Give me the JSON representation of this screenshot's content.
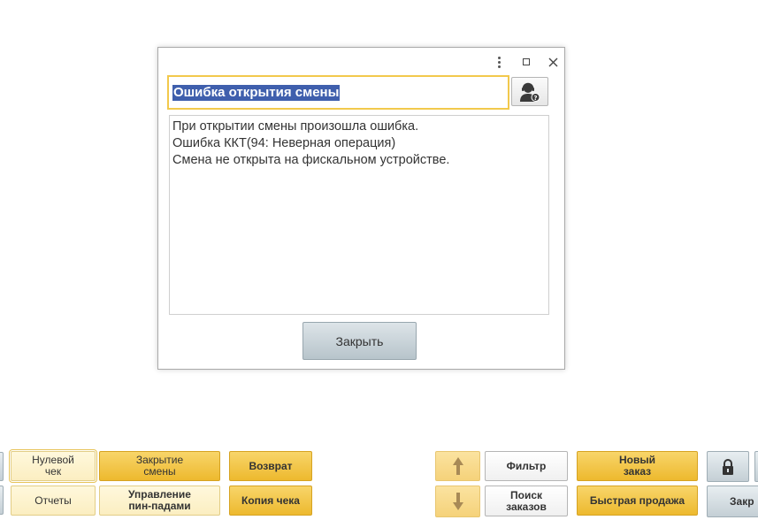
{
  "dialog": {
    "title": "Ошибка открытия смены",
    "message_lines": [
      "При открытии смены произошла ошибка.",
      "Ошибка ККТ(94: Неверная операция)",
      "Смена не открыта на фискальном устройстве."
    ],
    "close_label": "Закрыть",
    "controls": [
      "more-options-icon",
      "maximize-icon",
      "close-icon"
    ]
  },
  "toolbar": {
    "zero_check": "Нулевой\nчек",
    "close_shift": "Закрытие\nсмены",
    "return": "Возврат",
    "reports": "Отчеты",
    "pinpad_management": "Управление\nпин-падами",
    "receipt_copy": "Копия чека",
    "filter": "Фильтр",
    "order_search": "Поиск\nзаказов",
    "new_order": "Новый\nзаказ",
    "quick_sale": "Быстрая продажа",
    "close_partial": "Закр"
  },
  "colors": {
    "selection": "#3f5fad",
    "focus_border": "#f2c94c",
    "primary_button": "#edb92e",
    "dialog_button": "#b7c4cb"
  }
}
